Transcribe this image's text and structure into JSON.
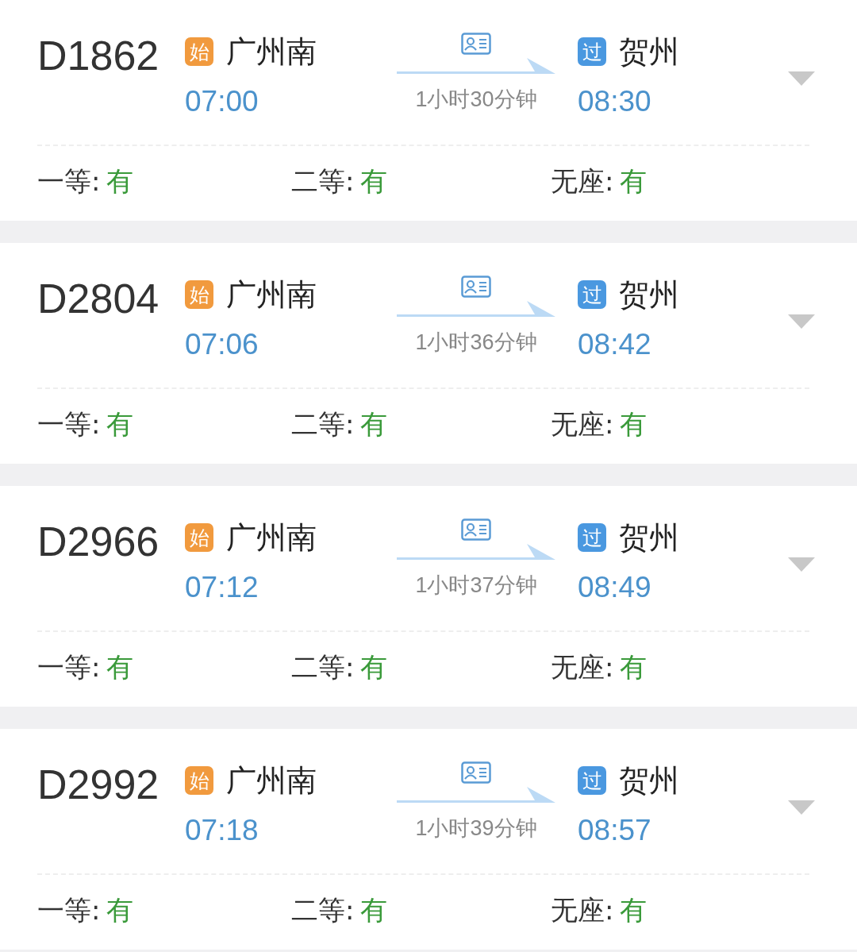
{
  "trains": [
    {
      "number": "D1862",
      "from": {
        "badge": "始",
        "kind": "start",
        "station": "广州南",
        "time": "07:00"
      },
      "duration": "1小时30分钟",
      "to": {
        "badge": "过",
        "kind": "pass",
        "station": "贺州",
        "time": "08:30"
      },
      "seats": [
        {
          "label": "一等:",
          "value": "有"
        },
        {
          "label": "二等:",
          "value": "有"
        },
        {
          "label": "无座:",
          "value": "有"
        }
      ]
    },
    {
      "number": "D2804",
      "from": {
        "badge": "始",
        "kind": "start",
        "station": "广州南",
        "time": "07:06"
      },
      "duration": "1小时36分钟",
      "to": {
        "badge": "过",
        "kind": "pass",
        "station": "贺州",
        "time": "08:42"
      },
      "seats": [
        {
          "label": "一等:",
          "value": "有"
        },
        {
          "label": "二等:",
          "value": "有"
        },
        {
          "label": "无座:",
          "value": "有"
        }
      ]
    },
    {
      "number": "D2966",
      "from": {
        "badge": "始",
        "kind": "start",
        "station": "广州南",
        "time": "07:12"
      },
      "duration": "1小时37分钟",
      "to": {
        "badge": "过",
        "kind": "pass",
        "station": "贺州",
        "time": "08:49"
      },
      "seats": [
        {
          "label": "一等:",
          "value": "有"
        },
        {
          "label": "二等:",
          "value": "有"
        },
        {
          "label": "无座:",
          "value": "有"
        }
      ]
    },
    {
      "number": "D2992",
      "from": {
        "badge": "始",
        "kind": "start",
        "station": "广州南",
        "time": "07:18"
      },
      "duration": "1小时39分钟",
      "to": {
        "badge": "过",
        "kind": "pass",
        "station": "贺州",
        "time": "08:57"
      },
      "seats": [
        {
          "label": "一等:",
          "value": "有"
        },
        {
          "label": "二等:",
          "value": "有"
        },
        {
          "label": "无座:",
          "value": "有"
        }
      ]
    }
  ]
}
